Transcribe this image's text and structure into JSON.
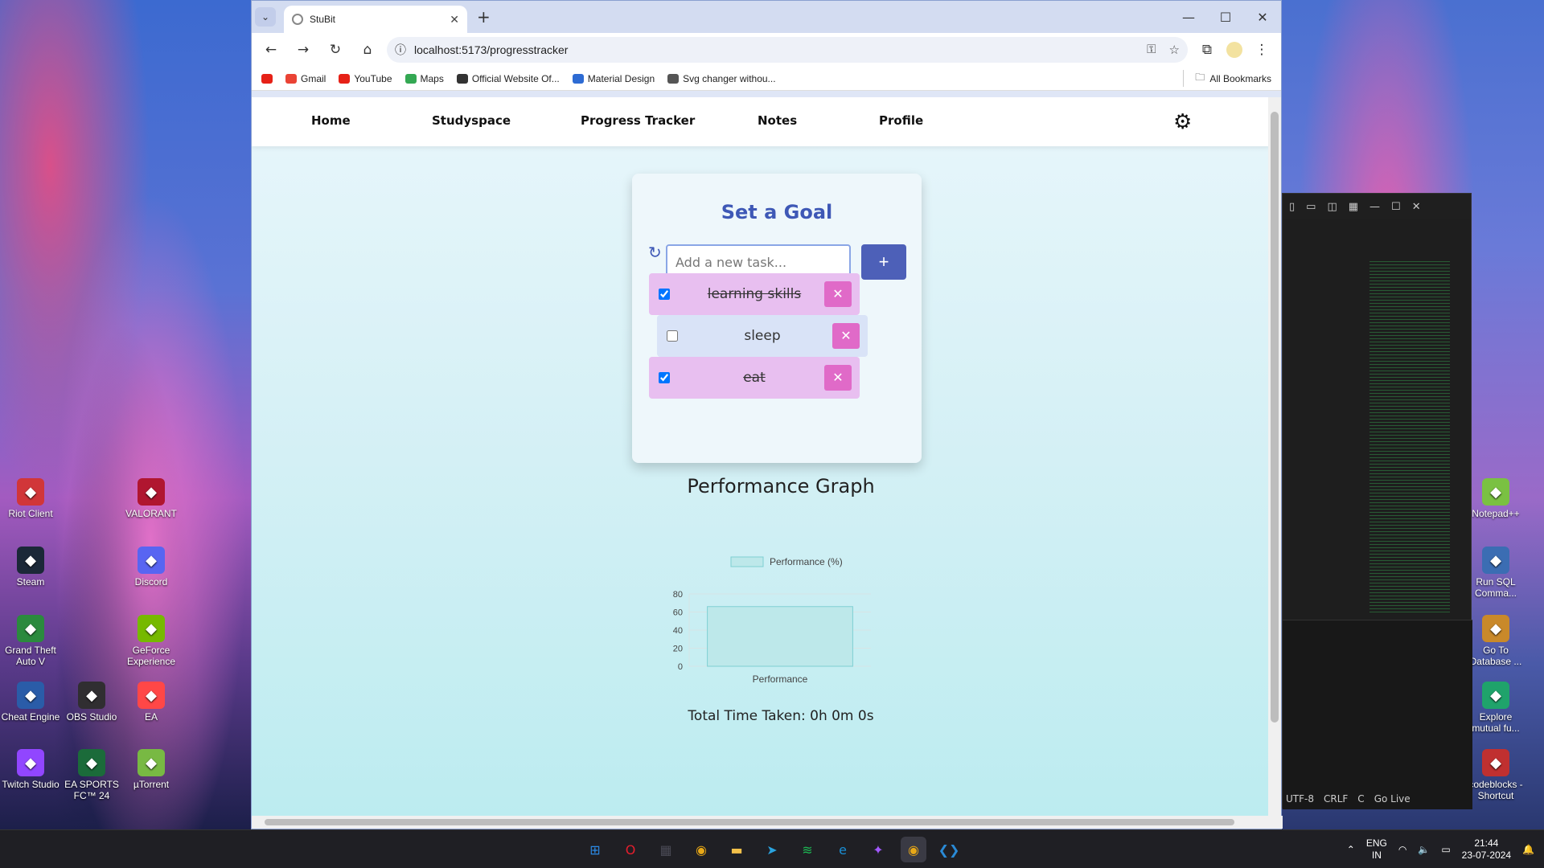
{
  "desktop": {
    "left_icons": [
      {
        "label": "Riot Client",
        "color": "#d13639"
      },
      {
        "label": "VALORANT",
        "color": "#b01630"
      },
      {
        "label": "Steam",
        "color": "#1b2838"
      },
      {
        "label": "Discord",
        "color": "#5865f2"
      },
      {
        "label": "Grand Theft Auto V",
        "color": "#2b8a3e"
      },
      {
        "label": "GeForce Experience",
        "color": "#76b900"
      },
      {
        "label": "Cheat Engine",
        "color": "#2a5ca8"
      },
      {
        "label": "OBS Studio",
        "color": "#302e31"
      },
      {
        "label": "EA",
        "color": "#ff4747"
      },
      {
        "label": "Twitch Studio",
        "color": "#9146ff"
      },
      {
        "label": "EA SPORTS FC™ 24",
        "color": "#1b6b3a"
      },
      {
        "label": "µTorrent",
        "color": "#78b943"
      }
    ],
    "right_icons": [
      {
        "label": "Notepad++",
        "color": "#7ac142"
      },
      {
        "label": "Run SQL Comma...",
        "color": "#3b6db3"
      },
      {
        "label": "Go To Database ...",
        "color": "#c9892a"
      },
      {
        "label": "Explore mutual fu...",
        "color": "#1fa36b"
      },
      {
        "label": "codeblocks - Shortcut",
        "color": "#c03030"
      }
    ]
  },
  "vscode": {
    "status": [
      "UTF-8",
      "CRLF",
      "C",
      "Go Live"
    ]
  },
  "browser": {
    "tab_title": "StuBit",
    "url": "localhost:5173/progresstracker",
    "bookmarks": [
      {
        "label": "",
        "color": "#e62117"
      },
      {
        "label": "Gmail",
        "color": "#ea4335"
      },
      {
        "label": "YouTube",
        "color": "#e62117"
      },
      {
        "label": "Maps",
        "color": "#34a853"
      },
      {
        "label": "Official Website Of...",
        "color": "#333333"
      },
      {
        "label": "Material Design",
        "color": "#2d6bd3"
      },
      {
        "label": "Svg changer withou...",
        "color": "#555555"
      }
    ],
    "all_bookmarks": "All Bookmarks"
  },
  "app": {
    "nav": [
      "Home",
      "Studyspace",
      "Progress Tracker",
      "Notes",
      "Profile"
    ],
    "goal": {
      "title": "Set a Goal",
      "input_placeholder": "Add a new task...",
      "add_label": "+",
      "delete_label": "✕",
      "tasks": [
        {
          "label": "learning skills",
          "done": true
        },
        {
          "label": "sleep",
          "done": false
        },
        {
          "label": "eat",
          "done": true
        }
      ]
    },
    "performance_title": "Performance Graph",
    "total_time": "Total Time Taken: 0h 0m 0s"
  },
  "chart_data": {
    "type": "bar",
    "categories": [
      "Performance"
    ],
    "series": [
      {
        "name": "Performance (%)",
        "values": [
          66
        ]
      }
    ],
    "ylim": [
      0,
      80
    ],
    "yticks": [
      0,
      20,
      40,
      60,
      80
    ],
    "legend": "top",
    "grid": true,
    "colors": {
      "fill": "#bde8ea",
      "stroke": "#7fcfd3"
    }
  },
  "taskbar": {
    "apps": [
      {
        "name": "windows-start-icon",
        "color": "#2b8ae6",
        "glyph": "⊞"
      },
      {
        "name": "opera-icon",
        "color": "#e51e2d",
        "glyph": "O"
      },
      {
        "name": "store-icon",
        "color": "#4a4a55",
        "glyph": "▦"
      },
      {
        "name": "chrome-icon",
        "color": "#e8a817",
        "glyph": "◉"
      },
      {
        "name": "file-explorer-icon",
        "color": "#f2c04a",
        "glyph": "▬"
      },
      {
        "name": "telegram-icon",
        "color": "#2aa3df",
        "glyph": "➤"
      },
      {
        "name": "spotify-icon",
        "color": "#1db954",
        "glyph": "≋"
      },
      {
        "name": "edge-icon",
        "color": "#1a8fd6",
        "glyph": "e"
      },
      {
        "name": "figma-icon",
        "color": "#a259ff",
        "glyph": "✦"
      },
      {
        "name": "chrome-active-icon",
        "color": "#e8a817",
        "glyph": "◉"
      },
      {
        "name": "vscode-icon",
        "color": "#2a8ad6",
        "glyph": "❮❯"
      }
    ],
    "lang_top": "ENG",
    "lang_bottom": "IN",
    "time": "21:44",
    "date": "23-07-2024"
  }
}
